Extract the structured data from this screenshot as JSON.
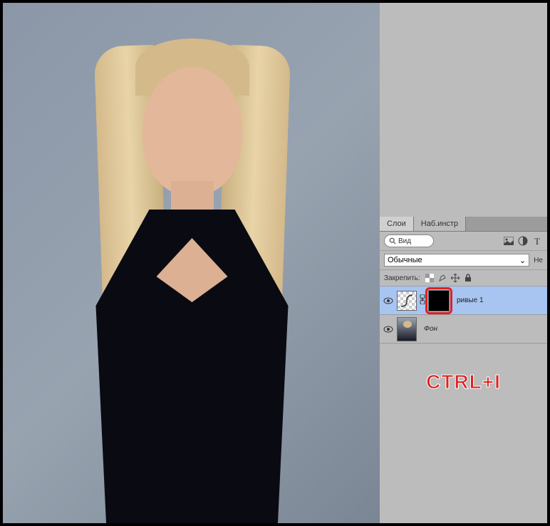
{
  "tabs": {
    "layers": "Слои",
    "toolPresets": "Наб.инстр"
  },
  "filter": {
    "searchLabel": "Вид"
  },
  "blend": {
    "mode": "Обычные",
    "opacityLabel": "Не"
  },
  "lock": {
    "label": "Закрепить:"
  },
  "layers": [
    {
      "name": "ривые 1",
      "italic": false
    },
    {
      "name": "Фон",
      "italic": true
    }
  ],
  "shortcut": "CTRL+I"
}
